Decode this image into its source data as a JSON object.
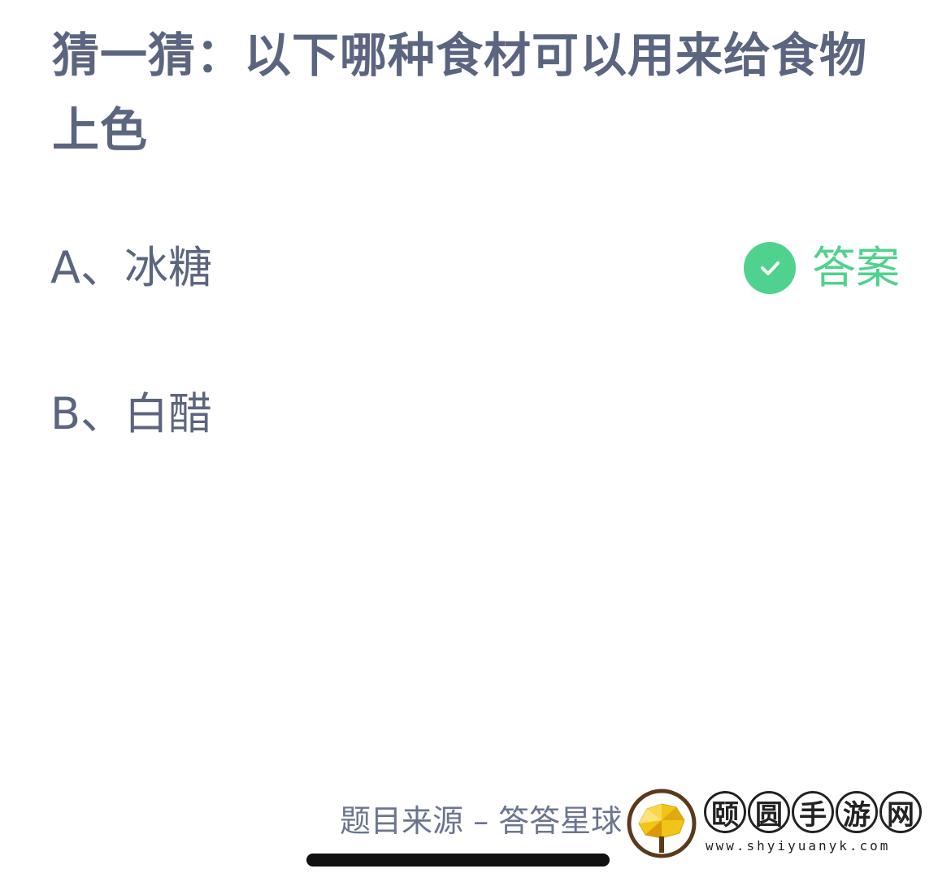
{
  "question": {
    "text": "猜一猜：以下哪种食材可以用来给食物上色"
  },
  "options": [
    {
      "label": "A、冰糖"
    },
    {
      "label": "B、白醋"
    }
  ],
  "answer_badge": {
    "label": "答案",
    "icon": "check-icon",
    "color": "#4fd28e"
  },
  "footer": {
    "source": "题目来源 – 答答星球"
  },
  "watermark": {
    "chars": [
      "颐",
      "圆",
      "手",
      "游",
      "网"
    ],
    "url": "www.shyiyuanyk.com"
  },
  "colors": {
    "text": "#5b6580",
    "accent": "#4fd28e"
  }
}
